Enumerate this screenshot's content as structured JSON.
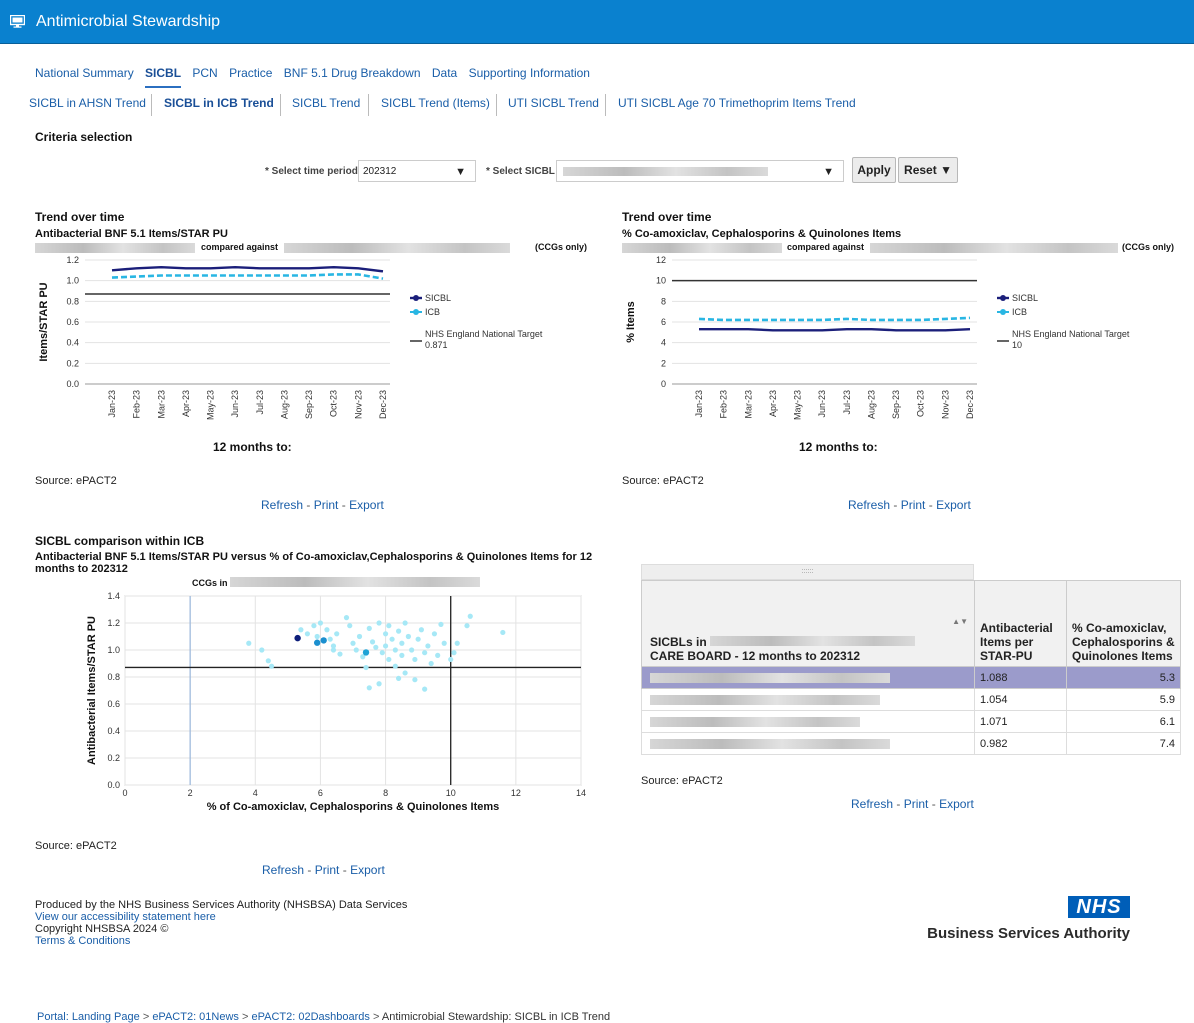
{
  "app": {
    "title": "Antimicrobial Stewardship"
  },
  "nav": {
    "tabs": [
      "National Summary",
      "SICBL",
      "PCN",
      "Practice",
      "BNF 5.1 Drug Breakdown",
      "Data",
      "Supporting Information"
    ],
    "selected_tab": "SICBL",
    "subtabs": [
      "SICBL in AHSN Trend",
      "SICBL in ICB Trend",
      "SICBL Trend",
      "SICBL Trend (Items)",
      "UTI SICBL Trend",
      "UTI SICBL Age 70 Trimethoprim Items Trend"
    ],
    "selected_subtab": "SICBL in ICB Trend"
  },
  "criteria": {
    "heading": "Criteria selection",
    "time_label": "* Select time period",
    "time_value": "202312",
    "sicbl_label": "* Select SICBL",
    "apply": "Apply",
    "reset": "Reset",
    "reset_icon": "caret-down-icon"
  },
  "charts_top": [
    {
      "section": "Trend over time",
      "subtitle": "Antibacterial BNF 5.1 Items/STAR PU",
      "compared": "compared against",
      "ccgs": "(CCGs only)",
      "xlabel": "12 months to:",
      "ylabel": "Items/STAR PU",
      "legend": [
        "SICBL",
        "ICB",
        "NHS England National Target",
        "0.871"
      ],
      "source": "Source: ePACT2"
    },
    {
      "section": "Trend over time",
      "subtitle": "% Co-amoxiclav, Cephalosporins & Quinolones Items",
      "compared": "compared against",
      "ccgs": "(CCGs only)",
      "xlabel": "12 months to:",
      "ylabel": "% Items",
      "legend": [
        "SICBL",
        "ICB",
        "NHS England National Target",
        "10"
      ],
      "source": "Source: ePACT2"
    }
  ],
  "scatter_section": {
    "section": "SICBL comparison within ICB",
    "title": "Antibacterial BNF 5.1 Items/STAR PU versus % of Co-amoxiclav,Cephalosporins & Quinolones Items for 12 months to 202312",
    "ccgs_in": "CCGs in",
    "xlabel": "% of Co-amoxiclav, Cephalosporins & Quinolones Items",
    "ylabel": "Antibacterial Items/STAR PU",
    "source": "Source: ePACT2"
  },
  "table": {
    "grip": "::::::",
    "header_name": "SICBLs in",
    "header_name2": "CARE BOARD - 12 months to 202312",
    "header_items": "Antibacterial Items per STAR-PU",
    "header_pct": "% Co-amoxiclav, Cephalosporins & Quinolones Items",
    "sort_icon": "sort-arrows-icon",
    "rows": [
      {
        "items": "1.088",
        "pct": "5.3",
        "highlight": true
      },
      {
        "items": "1.054",
        "pct": "5.9",
        "highlight": false
      },
      {
        "items": "1.071",
        "pct": "6.1",
        "highlight": false
      },
      {
        "items": "0.982",
        "pct": "7.4",
        "highlight": false
      }
    ],
    "source": "Source: ePACT2"
  },
  "actions": {
    "refresh": "Refresh",
    "print": "Print",
    "export": "Export",
    "sep": "-"
  },
  "footer": {
    "produced": "Produced by the NHS Business Services Authority (NHSBSA) Data Services",
    "accessibility": "View our accessibility statement here",
    "copyright": "Copyright NHSBSA 2024 ©",
    "terms": "Terms & Conditions",
    "logo_nhs": "NHS",
    "logo_text": "Business Services Authority"
  },
  "breadcrumb": {
    "items": [
      "Portal: Landing Page",
      "ePACT2: 01News",
      "ePACT2: 02Dashboards"
    ],
    "separator": ">",
    "current": "Antimicrobial Stewardship: SICBL in ICB Trend"
  },
  "colors": {
    "titlebar": "#0a81cf",
    "sicbl": "#1b1f7a",
    "icb": "#29b6e3",
    "target": "#333333",
    "highlight_row": "#9b9bcb",
    "scatter_light": "#a6e8f6",
    "scatter_dark": "#0d1e7a"
  },
  "chart_data": [
    {
      "type": "line",
      "x": [
        "Jan-23",
        "Feb-23",
        "Mar-23",
        "Apr-23",
        "May-23",
        "Jun-23",
        "Jul-23",
        "Aug-23",
        "Sep-23",
        "Oct-23",
        "Nov-23",
        "Dec-23"
      ],
      "series": [
        {
          "name": "SICBL",
          "values": [
            1.1,
            1.12,
            1.13,
            1.12,
            1.12,
            1.13,
            1.12,
            1.12,
            1.12,
            1.13,
            1.12,
            1.09
          ]
        },
        {
          "name": "ICB",
          "values": [
            1.03,
            1.04,
            1.05,
            1.05,
            1.05,
            1.05,
            1.05,
            1.05,
            1.05,
            1.06,
            1.06,
            1.02
          ]
        },
        {
          "name": "NHS England National Target",
          "values": [
            0.871,
            0.871,
            0.871,
            0.871,
            0.871,
            0.871,
            0.871,
            0.871,
            0.871,
            0.871,
            0.871,
            0.871
          ]
        }
      ],
      "yticks": [
        "0.0",
        "0.2",
        "0.4",
        "0.6",
        "0.8",
        "1.0",
        "1.2"
      ],
      "ylim": [
        0,
        1.2
      ]
    },
    {
      "type": "line",
      "x": [
        "Jan-23",
        "Feb-23",
        "Mar-23",
        "Apr-23",
        "May-23",
        "Jun-23",
        "Jul-23",
        "Aug-23",
        "Sep-23",
        "Oct-23",
        "Nov-23",
        "Dec-23"
      ],
      "series": [
        {
          "name": "SICBL",
          "values": [
            5.3,
            5.3,
            5.3,
            5.2,
            5.2,
            5.2,
            5.3,
            5.3,
            5.2,
            5.2,
            5.2,
            5.3
          ]
        },
        {
          "name": "ICB",
          "values": [
            6.3,
            6.2,
            6.2,
            6.2,
            6.2,
            6.2,
            6.3,
            6.2,
            6.2,
            6.2,
            6.3,
            6.4
          ]
        },
        {
          "name": "NHS England National Target",
          "values": [
            10,
            10,
            10,
            10,
            10,
            10,
            10,
            10,
            10,
            10,
            10,
            10
          ]
        }
      ],
      "yticks": [
        "0",
        "2",
        "4",
        "6",
        "8",
        "10",
        "12"
      ],
      "ylim": [
        0,
        12
      ]
    },
    {
      "type": "scatter",
      "xticks": [
        "0",
        "2",
        "4",
        "6",
        "8",
        "10",
        "12",
        "14"
      ],
      "yticks": [
        "0.0",
        "0.2",
        "0.4",
        "0.6",
        "0.8",
        "1.0",
        "1.2",
        "1.4"
      ],
      "xlim": [
        0,
        14
      ],
      "ylim": [
        0,
        1.4
      ],
      "vertical_lines": [
        2,
        10
      ],
      "horizontal_line": 0.871,
      "highlight": [
        [
          5.3,
          1.088
        ],
        [
          5.9,
          1.054
        ],
        [
          6.1,
          1.071
        ],
        [
          7.4,
          0.982
        ]
      ],
      "points": [
        [
          3.8,
          1.05
        ],
        [
          4.2,
          1.0
        ],
        [
          4.4,
          0.92
        ],
        [
          4.5,
          0.88
        ],
        [
          5.4,
          1.15
        ],
        [
          5.6,
          1.12
        ],
        [
          5.8,
          1.18
        ],
        [
          5.9,
          1.1
        ],
        [
          6.0,
          1.2
        ],
        [
          6.2,
          1.15
        ],
        [
          6.3,
          1.08
        ],
        [
          6.4,
          1.03
        ],
        [
          6.5,
          1.12
        ],
        [
          6.6,
          0.97
        ],
        [
          6.8,
          1.24
        ],
        [
          6.9,
          1.18
        ],
        [
          7.0,
          1.05
        ],
        [
          7.1,
          1.0
        ],
        [
          7.2,
          1.1
        ],
        [
          7.3,
          0.95
        ],
        [
          7.5,
          1.16
        ],
        [
          7.6,
          1.06
        ],
        [
          7.7,
          1.02
        ],
        [
          7.8,
          1.2
        ],
        [
          7.9,
          0.98
        ],
        [
          8.0,
          1.12
        ],
        [
          8.0,
          1.03
        ],
        [
          8.1,
          0.93
        ],
        [
          8.1,
          1.18
        ],
        [
          8.2,
          1.08
        ],
        [
          8.3,
          1.0
        ],
        [
          8.3,
          0.88
        ],
        [
          8.4,
          1.14
        ],
        [
          8.5,
          1.05
        ],
        [
          8.5,
          0.96
        ],
        [
          8.6,
          1.2
        ],
        [
          8.6,
          0.83
        ],
        [
          8.7,
          1.1
        ],
        [
          8.8,
          1.0
        ],
        [
          8.9,
          0.93
        ],
        [
          9.0,
          1.08
        ],
        [
          9.1,
          1.15
        ],
        [
          9.2,
          0.98
        ],
        [
          9.3,
          1.03
        ],
        [
          9.4,
          0.9
        ],
        [
          9.5,
          1.12
        ],
        [
          9.6,
          0.96
        ],
        [
          9.8,
          1.05
        ],
        [
          10.0,
          0.93
        ],
        [
          10.1,
          0.98
        ],
        [
          10.2,
          1.05
        ],
        [
          10.5,
          1.18
        ],
        [
          10.6,
          1.25
        ],
        [
          11.6,
          1.13
        ],
        [
          7.4,
          0.87
        ],
        [
          7.8,
          0.75
        ],
        [
          8.4,
          0.79
        ],
        [
          8.9,
          0.78
        ],
        [
          9.2,
          0.71
        ],
        [
          7.5,
          0.72
        ],
        [
          6.4,
          1.0
        ],
        [
          9.7,
          1.19
        ]
      ]
    }
  ]
}
